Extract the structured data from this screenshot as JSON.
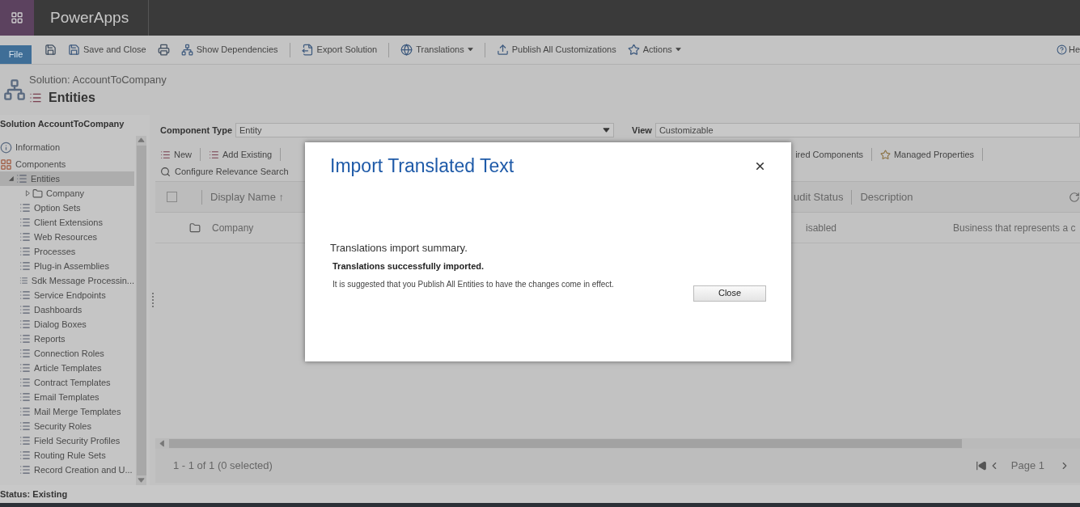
{
  "app_bar": {
    "title": "PowerApps"
  },
  "ribbon": {
    "file_tab": "File",
    "items": [
      {
        "kind": "icon"
      },
      {
        "kind": "button",
        "label": "Save and Close"
      },
      {
        "kind": "icon"
      },
      {
        "kind": "button",
        "label": "Show Dependencies"
      },
      {
        "kind": "separator"
      },
      {
        "kind": "button",
        "label": "Export Solution"
      },
      {
        "kind": "separator"
      },
      {
        "kind": "menu",
        "label": "Translations"
      },
      {
        "kind": "separator"
      },
      {
        "kind": "button",
        "label": "Publish All Customizations"
      },
      {
        "kind": "menu",
        "label": "Actions"
      }
    ],
    "help": "He"
  },
  "header": {
    "solution": "Solution: AccountToCompany",
    "title": "Entities"
  },
  "sidebar": {
    "title": "Solution AccountToCompany",
    "items": [
      {
        "label": "Information",
        "expanded": false,
        "selected": false
      },
      {
        "label": "Components",
        "expanded": true,
        "selected": false,
        "children": [
          {
            "label": "Entities",
            "expanded": true,
            "selected": true,
            "children": [
              {
                "label": "Company",
                "expanded": false,
                "selected": false
              }
            ]
          },
          {
            "label": "Option Sets",
            "selected": false
          },
          {
            "label": "Client Extensions",
            "selected": false
          },
          {
            "label": "Web Resources",
            "selected": false
          },
          {
            "label": "Processes",
            "selected": false
          },
          {
            "label": "Plug-in Assemblies",
            "selected": false
          },
          {
            "label": "Sdk Message Processin...",
            "selected": false
          },
          {
            "label": "Service Endpoints",
            "selected": false
          },
          {
            "label": "Dashboards",
            "selected": false
          },
          {
            "label": "Dialog Boxes",
            "selected": false
          },
          {
            "label": "Reports",
            "selected": false
          },
          {
            "label": "Connection Roles",
            "selected": false
          },
          {
            "label": "Article Templates",
            "selected": false
          },
          {
            "label": "Contract Templates",
            "selected": false
          },
          {
            "label": "Email Templates",
            "selected": false
          },
          {
            "label": "Mail Merge Templates",
            "selected": false
          },
          {
            "label": "Security Roles",
            "selected": false
          },
          {
            "label": "Field Security Profiles",
            "selected": false
          },
          {
            "label": "Routing Rule Sets",
            "selected": false
          },
          {
            "label": "Record Creation and U...",
            "selected": false
          }
        ]
      }
    ]
  },
  "filters": {
    "component_type_label": "Component Type",
    "component_type": "Entity",
    "view_label": "View",
    "view": "Customizable"
  },
  "grid_toolbar": {
    "left": [
      "New",
      "Add Existing"
    ],
    "right": [
      "ired Components",
      "Managed Properties"
    ],
    "search_action": "Configure Relevance Search"
  },
  "grid": {
    "columns_left": [
      "Display Name ↑"
    ],
    "columns_right": [
      "udit Status",
      "Description"
    ],
    "header_checked": false,
    "rows": [
      {
        "display_name": "Company",
        "audit_status": "isabled",
        "description": "Business that represents a c"
      }
    ]
  },
  "footer": {
    "summary": "1 - 1 of 1 (0 selected)",
    "page": "Page 1"
  },
  "status_bar": "Status: Existing",
  "dialog": {
    "title": "Import Translated Text",
    "summary": "Translations import summary.",
    "result": "Translations successfully imported.",
    "note": "It is suggested that you Publish All Entities to have the changes come in effect.",
    "button": "Close"
  }
}
